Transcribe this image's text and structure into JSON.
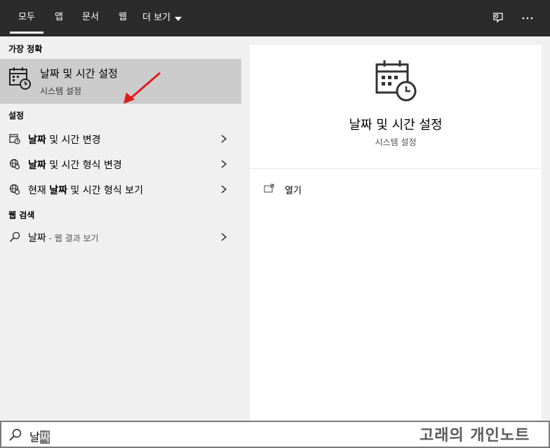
{
  "tabs": [
    {
      "label": "모두",
      "active": true
    },
    {
      "label": "앱"
    },
    {
      "label": "문서"
    },
    {
      "label": "웹"
    },
    {
      "label": "더 보기"
    }
  ],
  "topbar_icons": [
    "feedback-icon",
    "more-icon"
  ],
  "sections": {
    "best_match": "가장 정확",
    "settings": "설정",
    "web_search": "웹 검색"
  },
  "best_match_item": {
    "title": "날짜 및 시간 설정",
    "subtitle": "시스템 설정",
    "icon": "calendar-clock-icon"
  },
  "settings_items": [
    {
      "label_bold": "날짜",
      "label_rest": " 및 시간 변경",
      "icon": "date-time-icon"
    },
    {
      "label_bold": "날짜",
      "label_rest": " 및 시간 형식 변경",
      "icon": "region-icon"
    },
    {
      "label_prefix": "현재 ",
      "label_bold": "날짜",
      "label_rest": " 및 시간 형식 보기",
      "icon": "region-icon"
    }
  ],
  "web_item": {
    "term": "날짜",
    "suffix": " - 웹 결과 보기",
    "icon": "search-icon"
  },
  "detail": {
    "title": "날짜 및 시간 설정",
    "subtitle": "시스템 설정",
    "action_label": "열기",
    "action_icon": "open-icon"
  },
  "search": {
    "typed": "날",
    "selected": "짜"
  },
  "watermark": "고래의 개인노트",
  "colors": {
    "topbar": "#2b2b2b",
    "selected_row": "#cccccc",
    "arrow": "#e21b1b"
  }
}
